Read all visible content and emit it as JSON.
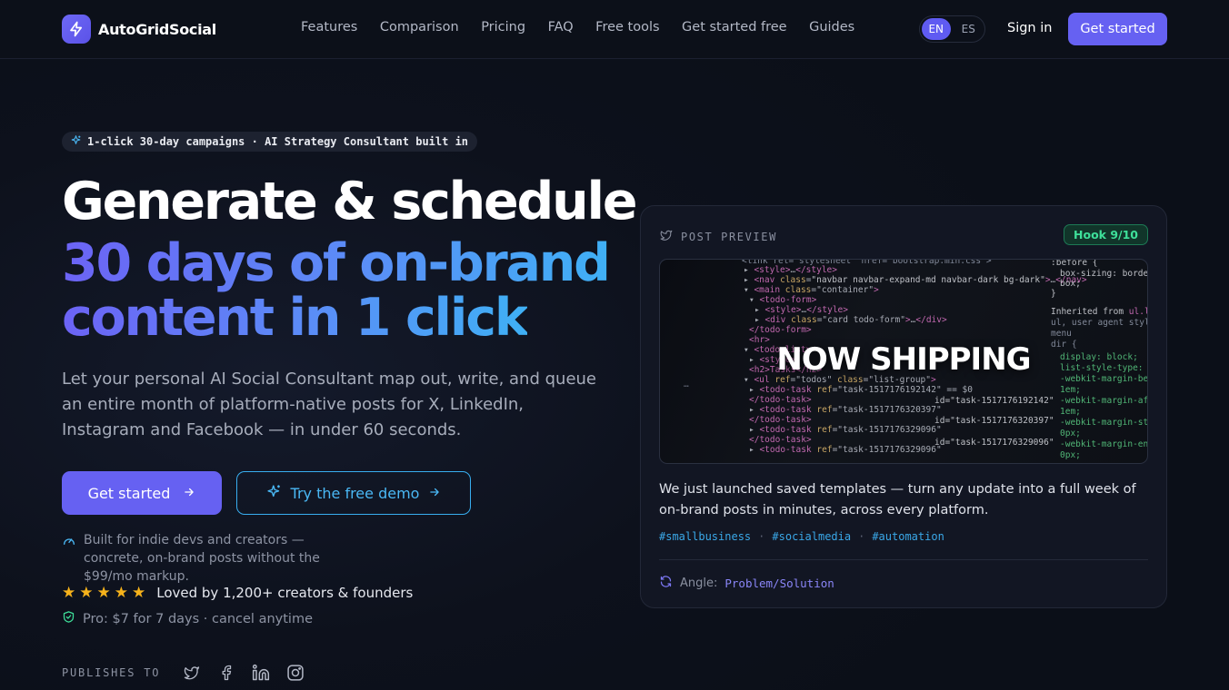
{
  "nav": {
    "brand": "AutoGridSocial",
    "links": [
      "Features",
      "Comparison",
      "Pricing",
      "FAQ",
      "Free tools",
      "Get started free",
      "Guides"
    ],
    "lang": [
      "EN",
      "ES"
    ],
    "signin": "Sign in",
    "cta": "Get started"
  },
  "hero": {
    "badge": "1-click 30-day campaigns · AI Strategy Consultant built in",
    "title_line1": "Generate & schedule",
    "title_line2": "30 days of on-brand",
    "title_line3": "content in 1 click",
    "lead": "Let your personal AI Social Consultant map out, write, and queue an entire month of platform-native posts for X, LinkedIn, Instagram and Facebook — in under 60 seconds.",
    "primary_cta": "Get started",
    "secondary_cta": "Try the free demo",
    "built_for": "Built for indie devs and creators — concrete, on-brand posts without the $99/mo markup.",
    "rating_stars": 5,
    "loved": "Loved by 1,200+ creators & founders",
    "pro": "Pro: $7 for 7 days · cancel anytime",
    "publishes_label": "PUBLISHES TO",
    "platforms": [
      "twitter-icon",
      "facebook-icon",
      "linkedin-icon",
      "instagram-icon"
    ]
  },
  "card": {
    "label": "POST PREVIEW",
    "hook": "Hook 9/10",
    "preview_title": "NOW SHIPPING",
    "post_text": "We just launched saved templates — turn any update into a full week of on-brand posts in minutes, across every platform.",
    "tags": [
      "#smallbusiness",
      "#socialmedia",
      "#automation"
    ],
    "angle_label": "Angle:",
    "angle_value": "Problem/Solution"
  },
  "colors": {
    "accent": "#6661f2",
    "accent_blue": "#38aef0",
    "hook_green": "#3ee09a",
    "star": "#f6b21b"
  }
}
